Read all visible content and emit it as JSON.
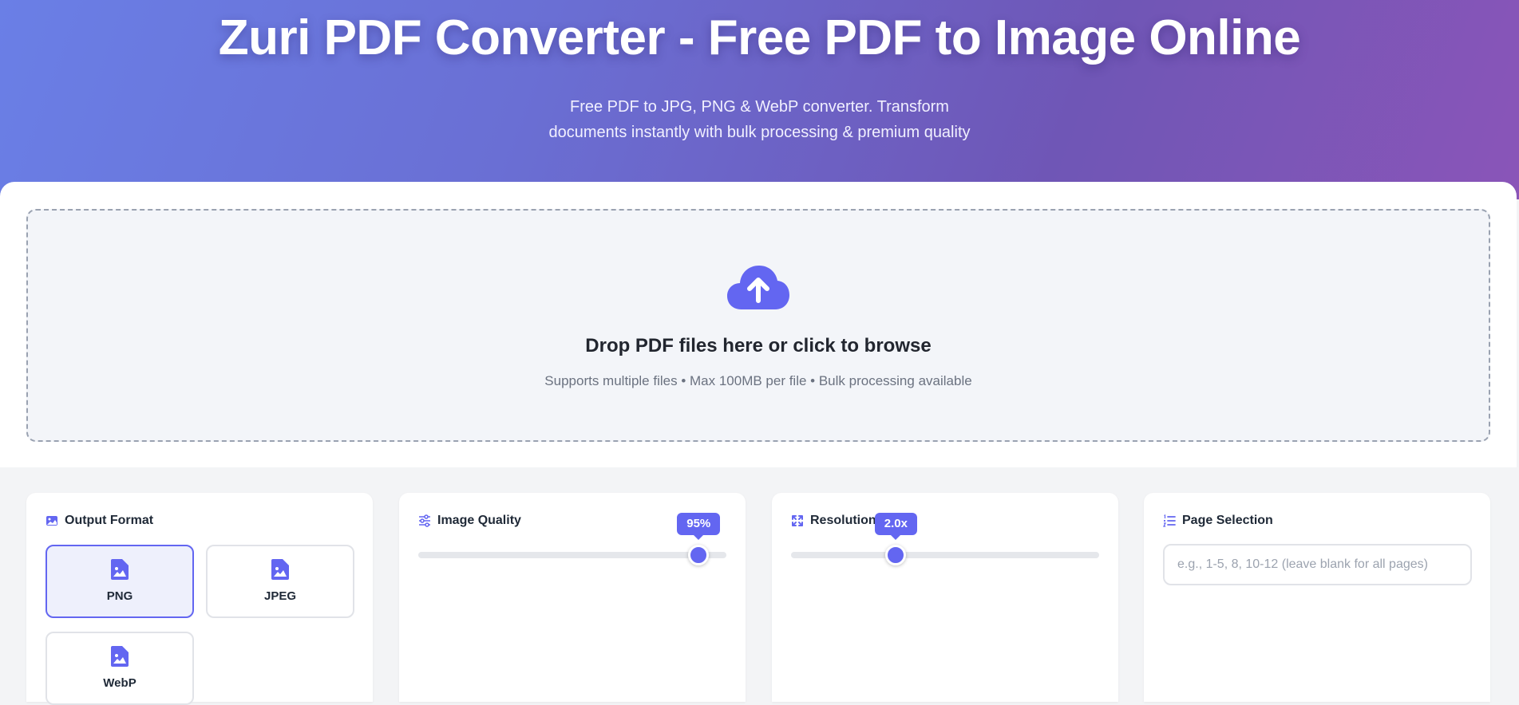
{
  "hero": {
    "title": "Zuri PDF Converter - Free PDF to Image Online",
    "subtitle_line1": "Free PDF to JPG, PNG & WebP converter. Transform",
    "subtitle_line2": "documents instantly with bulk processing & premium quality"
  },
  "dropzone": {
    "icon": "cloud-upload-icon",
    "title": "Drop PDF files here or click to browse",
    "hint": "Supports multiple files • Max 100MB per file • Bulk processing available"
  },
  "output_format": {
    "label": "Output Format",
    "icon": "image-icon",
    "options": [
      {
        "label": "PNG",
        "selected": true
      },
      {
        "label": "JPEG",
        "selected": false
      },
      {
        "label": "WebP",
        "selected": false
      }
    ]
  },
  "image_quality": {
    "label": "Image Quality",
    "icon": "sliders-icon",
    "value_label": "95%",
    "value": 0.91
  },
  "resolution_scale": {
    "label": "Resolution Scale",
    "icon": "expand-icon",
    "value_label": "2.0x",
    "value": 0.34
  },
  "page_selection": {
    "label": "Page Selection",
    "icon": "list-ordered-icon",
    "placeholder": "e.g., 1-5, 8, 10-12 (leave blank for all pages)",
    "value": ""
  },
  "colors": {
    "accent": "#6366f1",
    "hero_start": "#6a7fe6",
    "hero_end": "#8a55b8"
  }
}
